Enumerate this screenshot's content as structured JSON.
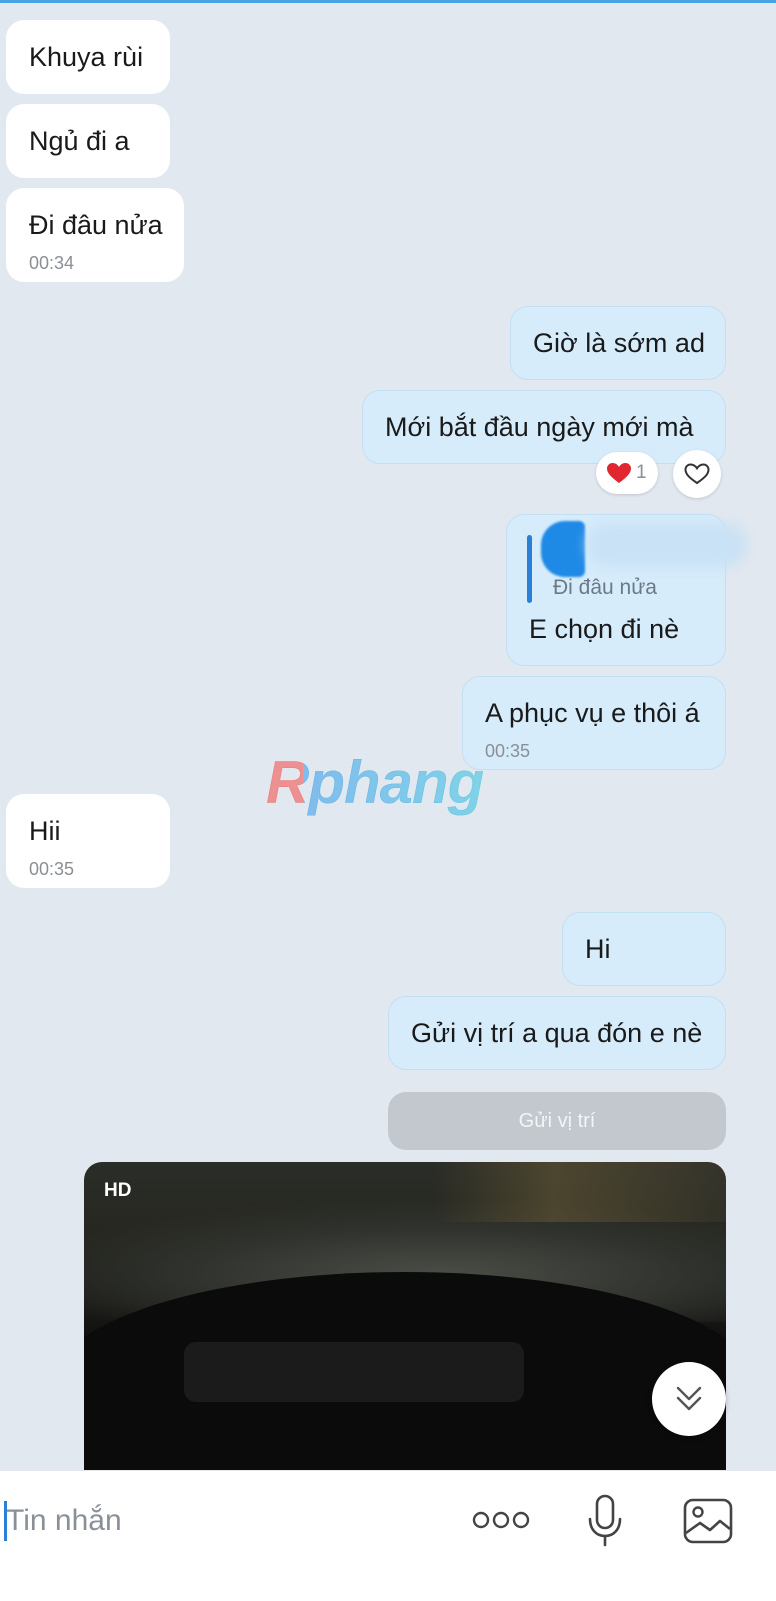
{
  "watermark": "Rphang",
  "messages": {
    "m1": "Khuya rùi",
    "m2": "Ngủ đi a",
    "m3": "Đi đâu nửa",
    "m3_time": "00:34",
    "m4": "Giờ là sớm ad",
    "m5": "Mới bắt đầu ngày mới mà",
    "m5_reaction_count": "1",
    "m6_quote": "Đi đâu nửa",
    "m6": "E chọn đi nè",
    "m7": "A phục vụ e thôi á",
    "m7_time": "00:35",
    "m8": "Hii",
    "m8_time": "00:35",
    "m9": "Hi",
    "m10": "Gửi vị trí a qua đón e nè",
    "location_button": "Gửi vị trí"
  },
  "video": {
    "badge": "HD"
  },
  "composer": {
    "placeholder": "Tin nhắn"
  },
  "icons": {
    "reaction": "heart-icon",
    "like": "heart-outline-icon",
    "scroll": "chevron-double-down-icon",
    "more": "more-dots-icon",
    "mic": "microphone-icon",
    "image": "image-icon"
  },
  "colors": {
    "incoming": "#ffffff",
    "outgoing": "#d6ecfb",
    "background": "#e2e8f0",
    "accent": "#2a7fd6"
  }
}
